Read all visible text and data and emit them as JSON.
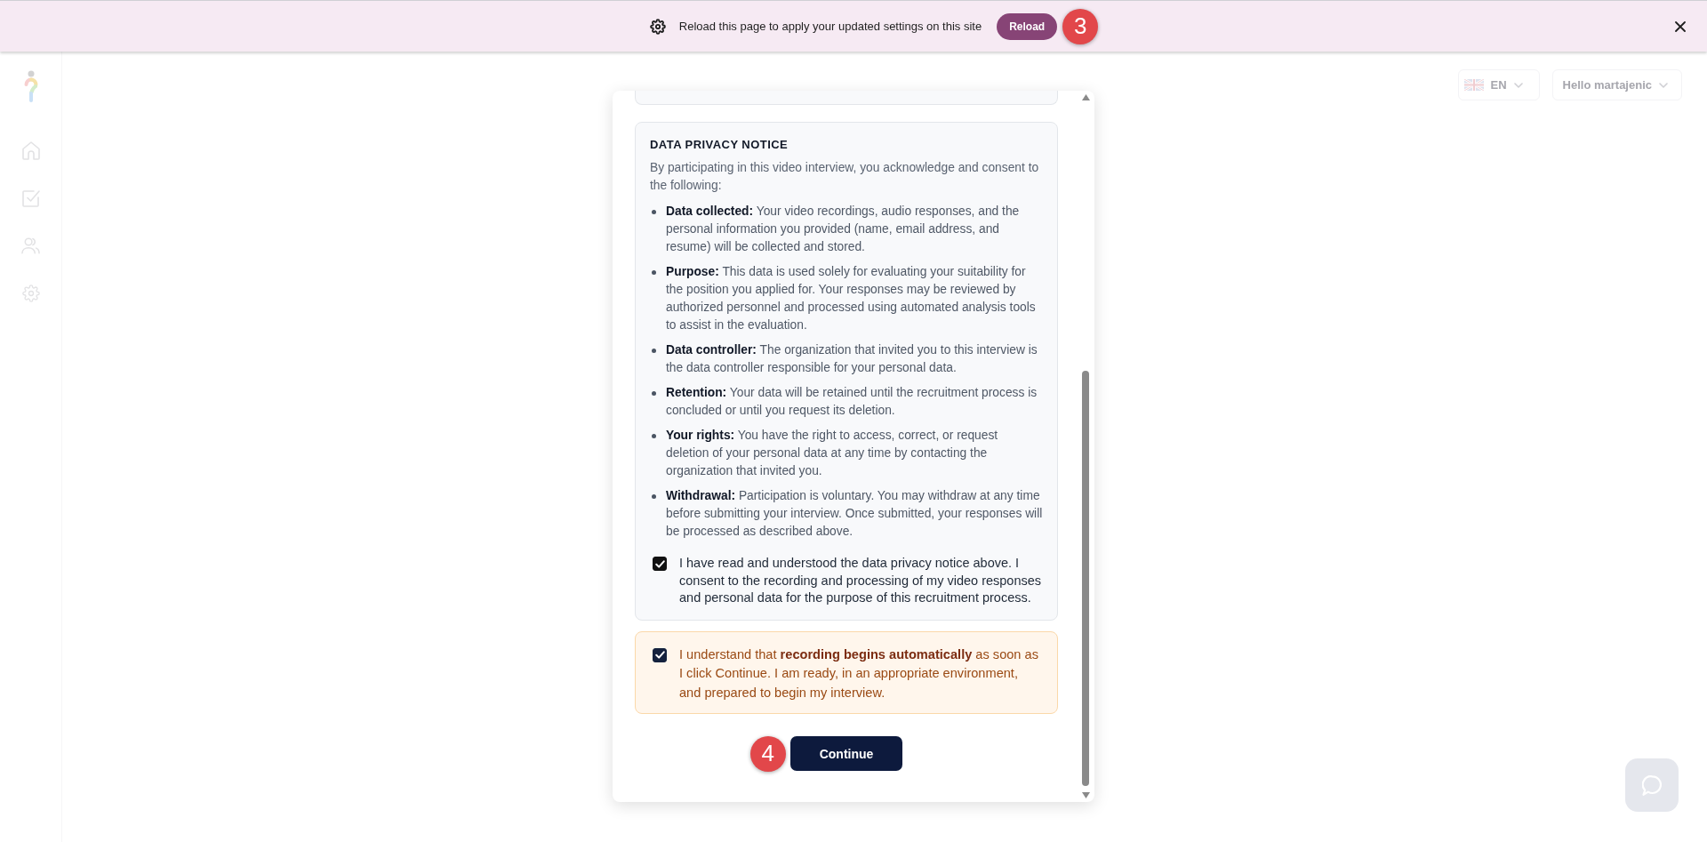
{
  "banner": {
    "message": "Reload this page to apply your updated settings on this site",
    "button": "Reload",
    "marker": "3"
  },
  "header": {
    "language": "EN",
    "greeting": "Hello martajenic"
  },
  "dialog": {
    "privacy_notice": {
      "title": "DATA PRIVACY NOTICE",
      "intro": "By participating in this video interview, you acknowledge and consent to the following:",
      "items": [
        "**Data collected:** Your video recordings, audio responses, and the personal information you provided (name, email address, and resume) will be collected and stored.",
        "**Purpose:** This data is used solely for evaluating your suitability for the position you applied for. Your responses may be reviewed by authorized personnel and processed using automated analysis tools to assist in the evaluation.",
        "**Data controller:** The organization that invited you to this interview is the data controller responsible for your personal data.",
        "**Retention:** Your data will be retained until the recruitment process is concluded or until you request its deletion.",
        "**Your rights:** You have the right to access, correct, or request deletion of your personal data at any time by contacting the organization that invited you.",
        "**Withdrawal:** Participation is voluntary. You may withdraw at any time before submitting your interview. Once submitted, your responses will be processed as described above."
      ],
      "consent": {
        "checked": true,
        "text": "I have read and understood the data privacy notice above. I consent to the recording and processing of my video responses and personal data for the purpose of this recruitment process."
      }
    },
    "acknowledgement": {
      "checked": true,
      "text": "I understand that **recording begins automatically** as soon as I click Continue. I am ready, in an appropriate environment, and prepared to begin my interview."
    },
    "button": "Continue",
    "marker": "4"
  }
}
